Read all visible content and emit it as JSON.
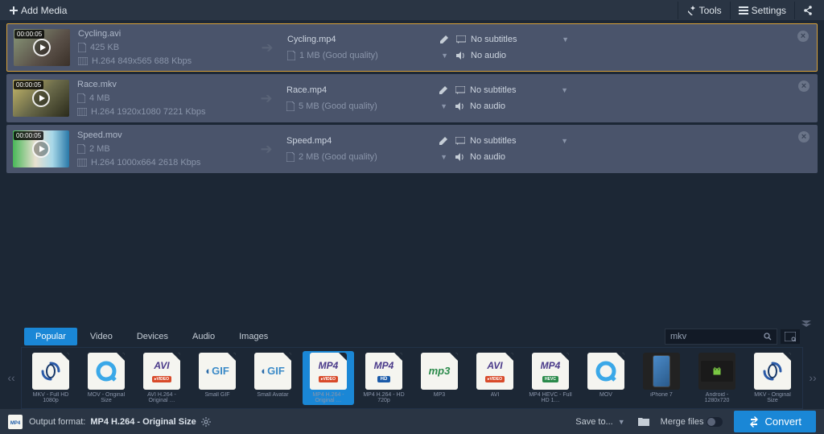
{
  "toolbar": {
    "add_media": "Add Media",
    "tools": "Tools",
    "settings": "Settings"
  },
  "files": [
    {
      "thumb_class": "cycling",
      "duration": "00:00:05",
      "name": "Cycling.avi",
      "size": "425 KB",
      "codec": "H.264 849x565 688 Kbps",
      "out_name": "Cycling.mp4",
      "out_desc": "1 MB (Good quality)",
      "subtitles": "No subtitles",
      "audio": "No audio",
      "selected": true
    },
    {
      "thumb_class": "race",
      "duration": "00:00:05",
      "name": "Race.mkv",
      "size": "4 MB",
      "codec": "H.264 1920x1080 7221 Kbps",
      "out_name": "Race.mp4",
      "out_desc": "5 MB (Good quality)",
      "subtitles": "No subtitles",
      "audio": "No audio",
      "selected": false
    },
    {
      "thumb_class": "speed",
      "duration": "00:00:05",
      "name": "Speed.mov",
      "size": "2 MB",
      "codec": "H.264 1000x664 2618 Kbps",
      "out_name": "Speed.mp4",
      "out_desc": "2 MB (Good quality)",
      "subtitles": "No subtitles",
      "audio": "No audio",
      "selected": false
    }
  ],
  "tabs": {
    "popular": "Popular",
    "video": "Video",
    "devices": "Devices",
    "audio": "Audio",
    "images": "Images"
  },
  "search": {
    "value": "mkv"
  },
  "presets": [
    {
      "label": "MKV - Full HD 1080p",
      "kind": "swirl"
    },
    {
      "label": "MOV - Original Size",
      "kind": "qt"
    },
    {
      "label": "AVI H.264 - Original …",
      "kind": "avi"
    },
    {
      "label": "Small GIF",
      "kind": "gif"
    },
    {
      "label": "Small Avatar",
      "kind": "gif"
    },
    {
      "label": "MP4 H.264 - Original …",
      "kind": "mp4",
      "active": true
    },
    {
      "label": "MP4 H.264 - HD 720p",
      "kind": "mp4hd"
    },
    {
      "label": "MP3",
      "kind": "mp3"
    },
    {
      "label": "AVI",
      "kind": "avi"
    },
    {
      "label": "MP4 HEVC - Full HD 1…",
      "kind": "mp4hevc"
    },
    {
      "label": "MOV",
      "kind": "qt"
    },
    {
      "label": "iPhone 7",
      "kind": "iphone"
    },
    {
      "label": "Android - 1280x720",
      "kind": "android"
    },
    {
      "label": "MKV - Original Size",
      "kind": "swirl"
    }
  ],
  "bottom": {
    "output_label": "Output format:",
    "output_value": "MP4 H.264 - Original Size",
    "save_to": "Save to...",
    "merge": "Merge files",
    "convert": "Convert"
  }
}
